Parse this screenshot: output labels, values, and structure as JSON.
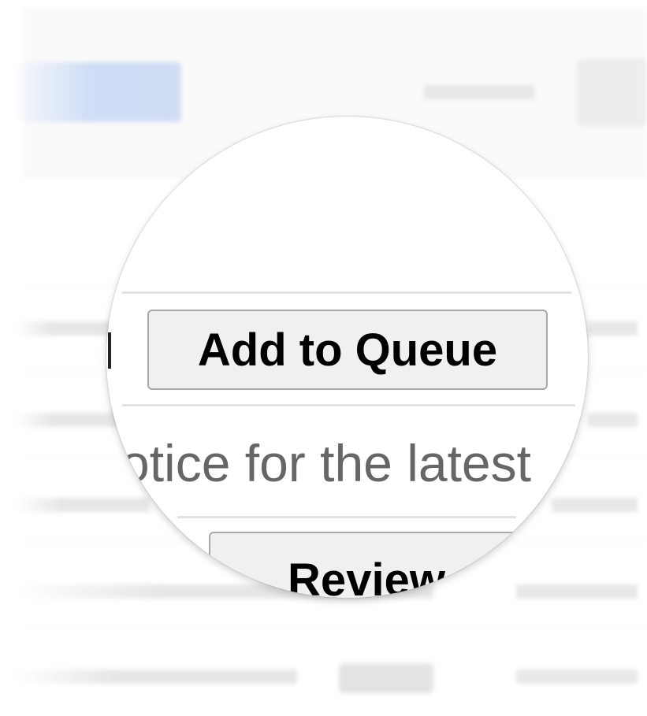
{
  "magnifier": {
    "primary_button_label": "Add to Queue",
    "notice_text": "otice for the latest",
    "secondary_button_label": "Review"
  },
  "colors": {
    "accent_blue": "#cddcf6",
    "button_bg": "#f0f0f0",
    "button_border": "#a8a8a8",
    "notice_text": "#666666"
  }
}
